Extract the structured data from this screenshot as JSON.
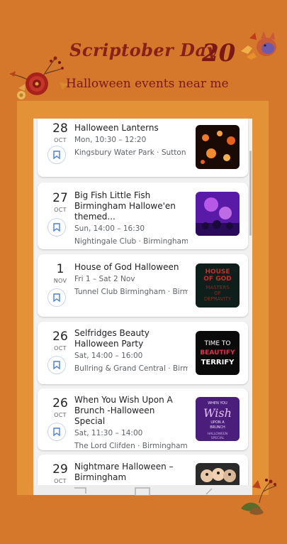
{
  "header": {
    "title": "Scriptober Day",
    "day_number": "20",
    "subtitle": "Halloween events near me"
  },
  "events": [
    {
      "day": "28",
      "month": "OCT",
      "title": "Halloween Lanterns",
      "time": "Mon, 10:30 – 12:20",
      "place": "Kingsbury Water Park · Sutton C..."
    },
    {
      "day": "27",
      "month": "OCT",
      "title": "Big Fish Little Fish Birmingham Hallowe'en themed...",
      "time": "Sun, 14:00 – 16:30",
      "place": "Nightingale Club · Birmingham"
    },
    {
      "day": "1",
      "month": "NOV",
      "title": "House of God Halloween",
      "time": "Fri 1 – Sat 2 Nov",
      "place": "Tunnel Club Birmingham · Birmi...",
      "thumb_text": [
        "HOUSE",
        "OF GOD",
        "MASTERS",
        "OF",
        "DEPRAVITY"
      ]
    },
    {
      "day": "26",
      "month": "OCT",
      "title": "Selfridges Beauty Halloween Party",
      "time": "Sat, 14:00 – 16:00",
      "place": "Bullring & Grand Central · Birmin...",
      "thumb_text": [
        "TIME TO",
        "BEAUTIFY",
        "TERRIFY"
      ]
    },
    {
      "day": "26",
      "month": "OCT",
      "title": "When You Wish Upon A Brunch -Halloween Special",
      "time": "Sat, 11:30 – 14:00",
      "place": "The Lord Clifden · Birmingham",
      "thumb_text": [
        "WHEN YOU",
        "Wish",
        "UPON A",
        "BRUNCH",
        "HALLOWEEN",
        "SPECIAL"
      ]
    },
    {
      "day": "29",
      "month": "OCT",
      "title": "Nightmare Halloween – Birmingham",
      "time": "",
      "place": ""
    }
  ],
  "colors": {
    "background": "#D5782C",
    "frame": "#E39238",
    "title_red": "#8A1F1A",
    "bookmark_blue": "#4A7BE0"
  },
  "icons": {
    "bookmark": "bookmark-icon",
    "decor_left": "autumn-flowers-decoration",
    "decor_right": "fox-leaves-decoration",
    "decor_bottom": "autumn-leaves-decoration"
  }
}
